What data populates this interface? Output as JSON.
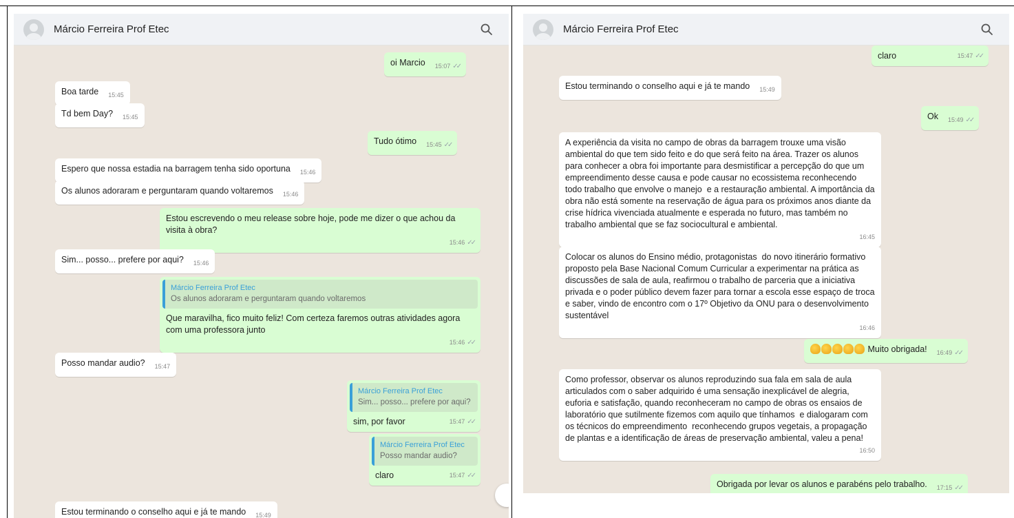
{
  "contact_name": "Márcio Ferreira Prof Etec",
  "left_panel": {
    "messages": [
      {
        "dir": "out",
        "text": "oi Marcio",
        "time": "15:07"
      },
      {
        "dir": "in",
        "text": "Boa tarde",
        "time": "15:45"
      },
      {
        "dir": "in",
        "text": "Td bem Day?",
        "time": "15:45"
      },
      {
        "dir": "out",
        "text": "Tudo ótimo",
        "time": "15:45"
      },
      {
        "dir": "in",
        "text": "Espero que nossa estadia na barragem tenha sido oportuna",
        "time": "15:46"
      },
      {
        "dir": "in",
        "text": "Os alunos adoraram e perguntaram quando voltaremos",
        "time": "15:46"
      },
      {
        "dir": "out",
        "text": "Estou escrevendo o meu release sobre hoje, pode me dizer o que achou da visita à obra?",
        "time": "15:46"
      },
      {
        "dir": "in",
        "text": "Sim... posso... prefere por aqui?",
        "time": "15:46"
      },
      {
        "dir": "out",
        "quote_name": "Márcio Ferreira Prof Etec",
        "quote_text": "Os alunos adoraram e perguntaram quando voltaremos",
        "text": "Que maravilha, fico muito feliz! Com certeza faremos outras atividades agora com uma professora junto",
        "time": "15:46"
      },
      {
        "dir": "in",
        "text": "Posso mandar audio?",
        "time": "15:47"
      },
      {
        "dir": "out",
        "quote_name": "Márcio Ferreira Prof Etec",
        "quote_text": "Sim... posso... prefere por aqui?",
        "text": "sim, por favor",
        "time": "15:47"
      },
      {
        "dir": "out",
        "quote_name": "Márcio Ferreira Prof Etec",
        "quote_text": "Posso mandar audio?",
        "text": "claro",
        "time": "15:47"
      },
      {
        "dir": "in",
        "text": "Estou terminando o conselho aqui e já te mando",
        "time": "15:49"
      }
    ]
  },
  "right_panel": {
    "messages": [
      {
        "dir": "out",
        "text": "claro",
        "time": "15:47"
      },
      {
        "dir": "in",
        "text": "Estou terminando o conselho aqui e já te mando",
        "time": "15:49"
      },
      {
        "dir": "out",
        "text": "Ok",
        "time": "15:49"
      },
      {
        "dir": "in",
        "text": "A experiência da visita no campo de obras da barragem trouxe uma visão ambiental do que tem sido feito e do que será feito na área. Trazer os alunos para conhecer a obra foi importante para desmistificar a percepção do que um empreendimento desse causa e pode causar no ecossistema reconhecendo todo trabalho que envolve o manejo  e a restauração ambiental. A importância da obra não está somente na reservação de água para os próximos anos diante da crise hídrica vivenciada atualmente e esperada no futuro, mas também no trabalho ambiental que se faz sociocultural e ambiental.",
        "time": "16:45"
      },
      {
        "dir": "in",
        "text": "Colocar os alunos do Ensino médio, protagonistas  do novo itinerário formativo proposto pela Base Nacional Comum Curricular a experimentar na prática as discussões de sala de aula, reafirmou o trabalho de parceria que a iniciativa privada e o poder público devem fazer para tornar a escola esse espaço de troca e saber, vindo de encontro com o 17º Objetivo da ONU para o desenvolvimento sustentável",
        "time": "16:46"
      },
      {
        "dir": "out",
        "emoji_count": 5,
        "text": "Muito obrigada!",
        "time": "16:49"
      },
      {
        "dir": "in",
        "text": "Como professor, observar os alunos reproduzindo sua fala em sala de aula articulados com o saber adquirido é uma sensação inexplicável de alegria, euforia e satisfação, quando reconheceram no campo de obras os ensaios de laboratório que sutilmente fizemos com aquilo que tínhamos  e dialogaram com os técnicos do empreendimento  reconhecendo grupos vegetais, a propagação de plantas e a identificação de áreas de preservação ambiental, valeu a pena!",
        "time": "16:50"
      },
      {
        "dir": "out",
        "text": "Obrigada por levar os alunos e parabéns pelo trabalho.",
        "time": "17:15"
      }
    ]
  },
  "colors": {
    "chat_bg": "#ece5dd",
    "incoming": "#ffffff",
    "outgoing": "#d9fdd3",
    "quote_accent": "#3aa0d8"
  }
}
